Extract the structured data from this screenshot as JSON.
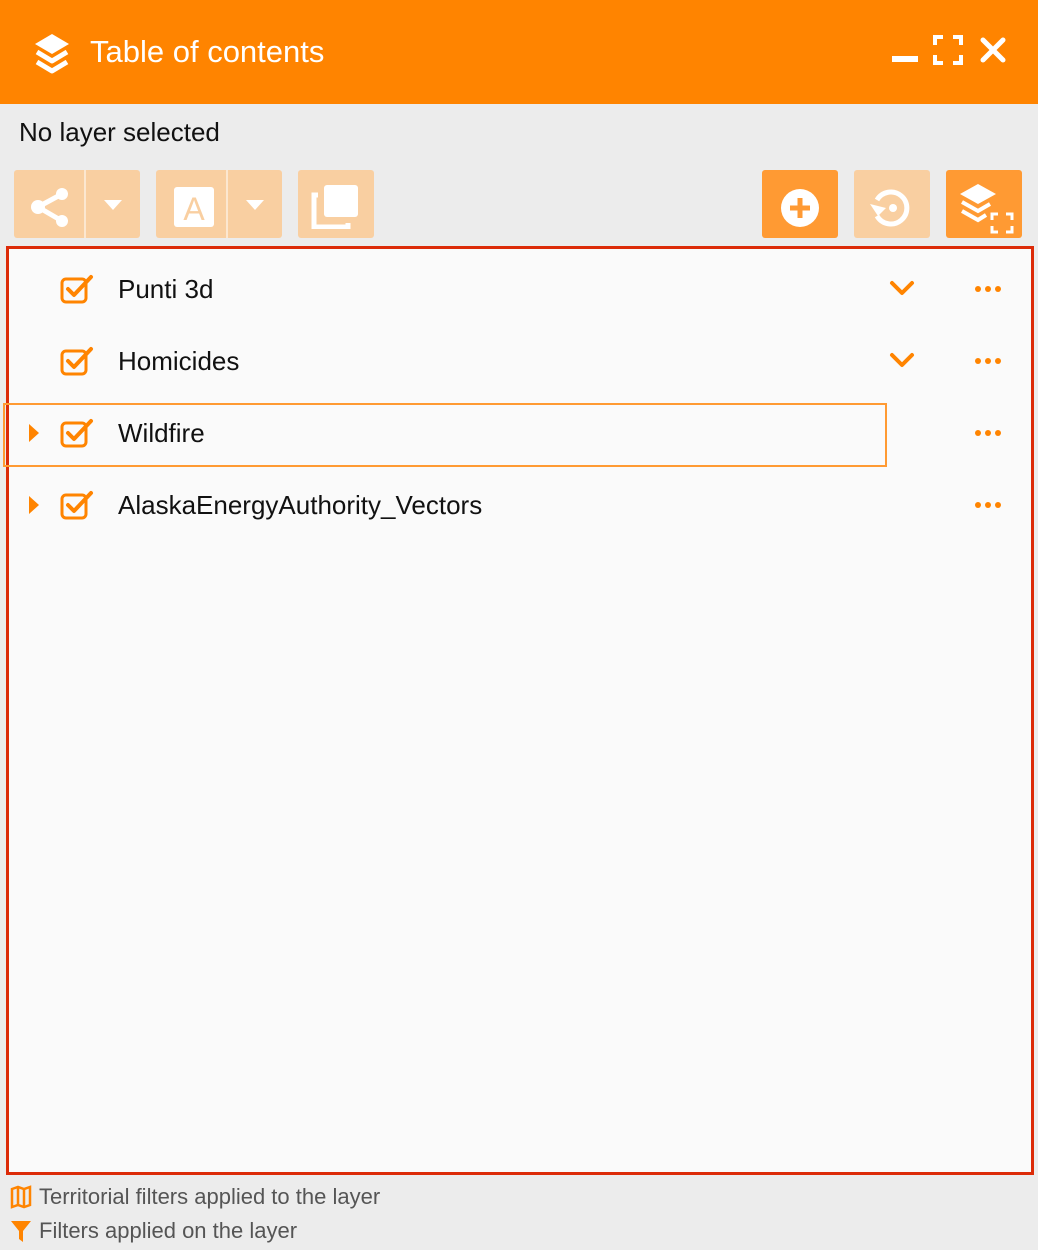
{
  "window": {
    "title": "Table of contents",
    "accent_color": "#ff8400",
    "controls": [
      "minimize-icon",
      "maximize-icon",
      "close-icon"
    ]
  },
  "status": {
    "text": "No layer selected"
  },
  "toolbar": {
    "left_buttons": [
      "share-icon",
      "chevron-down-icon",
      "label-icon",
      "chevron-down-icon",
      "duplicate-icon"
    ],
    "right_buttons": [
      "add-icon",
      "reset-icon",
      "layers-expand-icon"
    ]
  },
  "layers": [
    {
      "name": "Punti 3d",
      "checked": true,
      "expandable": false,
      "has_style_menu": true,
      "selected": false
    },
    {
      "name": "Homicides",
      "checked": true,
      "expandable": false,
      "has_style_menu": true,
      "selected": false
    },
    {
      "name": "Wildfire",
      "checked": true,
      "expandable": true,
      "has_style_menu": false,
      "selected": true
    },
    {
      "name": "AlaskaEnergyAuthority_Vectors",
      "checked": true,
      "expandable": true,
      "has_style_menu": false,
      "selected": false
    }
  ],
  "legend": {
    "territorial": "Territorial filters applied to the layer",
    "filters": "Filters applied on the layer"
  },
  "colors": {
    "panel_border": "#dc2b08",
    "icon_orange": "#ff8400",
    "button_light": "#f9cfa1",
    "button_solid": "#ff9a33"
  }
}
